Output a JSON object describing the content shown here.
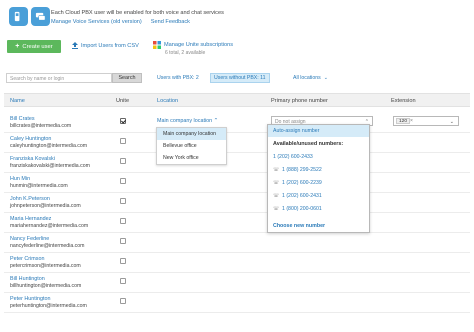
{
  "header": {
    "info_text": "Each Cloud PBX user will be enabled for both voice and chat services",
    "links": [
      "Manage Voice Services (old version)",
      "Send Feedback"
    ]
  },
  "toolbar": {
    "create_label": "Create user",
    "import_label": "Import Users from CSV",
    "manage_title": "Manage Unite subscriptions",
    "manage_sub": "6 total, 2 available"
  },
  "filters": {
    "search_placeholder": "Search by name or login",
    "search_button": "Search",
    "tab_with": "Users with PBX: 2",
    "tab_without": "Users without PBX: 11",
    "all_locations": "All locations"
  },
  "table": {
    "headers": {
      "name": "Name",
      "unite": "Unite",
      "location": "Location",
      "phone": "Primary phone number",
      "extension": "Extension"
    },
    "rows": [
      {
        "name": "Bill Crates",
        "email": "billcrates@intermedia.com"
      },
      {
        "name": "Caley Huntington",
        "email": "caleyhuntington@intermedia.com"
      },
      {
        "name": "Franziska Kovalski",
        "email": "franziskakovalski@intermedia.com"
      },
      {
        "name": "Hun Min",
        "email": "hunmin@intermedia.com"
      },
      {
        "name": "John K.Peterson",
        "email": "johnpeterson@intermedia.com"
      },
      {
        "name": "Maria Hernandez",
        "email": "mariahernandez@intermedia.com"
      },
      {
        "name": "Nancy Federline",
        "email": "nancyfederline@intermedia.com"
      },
      {
        "name": "Peter Crimson",
        "email": "petercrimson@intermedia.com"
      },
      {
        "name": "Bill Huntington",
        "email": "billhuntington@intermedia.com"
      },
      {
        "name": "Peter Huntington",
        "email": "peterhuntington@intermedia.com"
      }
    ],
    "first_row": {
      "location": "Main company location",
      "phone_placeholder": "Do not assign",
      "extension_value": "120",
      "extension_clear": "×"
    }
  },
  "location_dropdown": {
    "options": [
      "Main company location",
      "Bellevue office",
      "New York office"
    ]
  },
  "phone_dropdown": {
    "auto": "Auto-assign number",
    "heading": "Available/unused numbers:",
    "numbers": [
      "1 (202) 600-2433",
      "1 (888) 299-2522",
      "1 (202) 600-2239",
      "1 (202) 600-2431",
      "1 (800) 200-0601"
    ],
    "new_number": "Choose new number"
  },
  "colors": {
    "accent": "#2a7ab8",
    "create_green": "#5cb85c",
    "selection": "#d5ebf8"
  }
}
